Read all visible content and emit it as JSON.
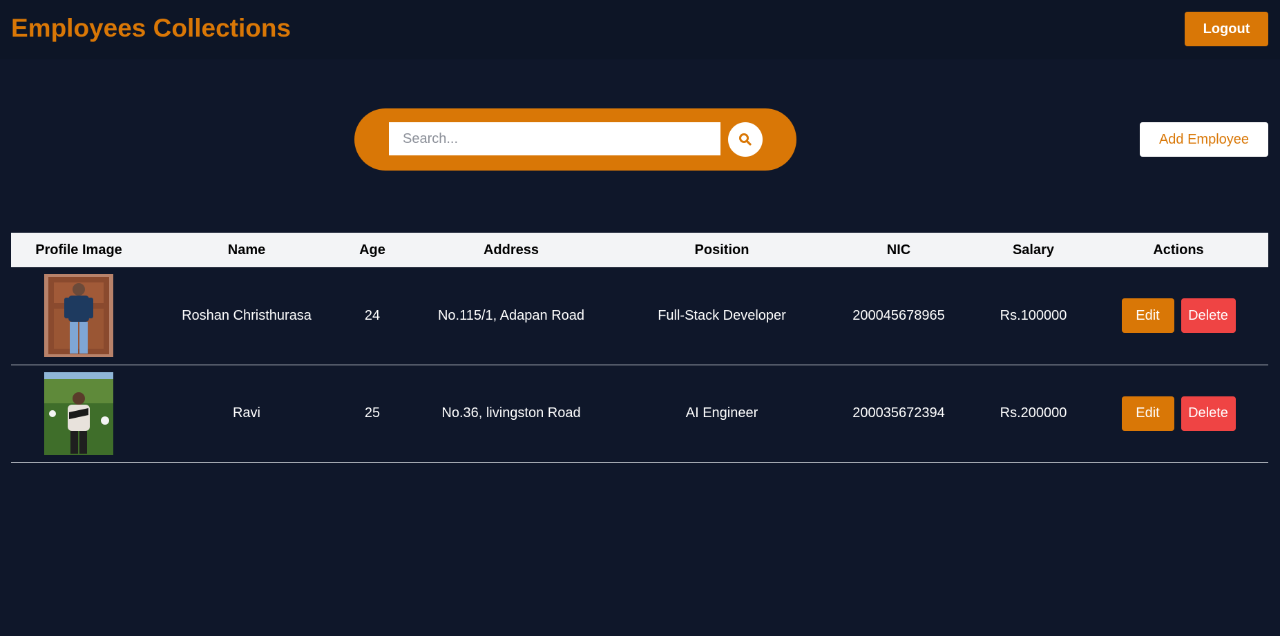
{
  "header": {
    "title": "Employees Collections",
    "logout_label": "Logout"
  },
  "search": {
    "placeholder": "Search...",
    "value": "",
    "icon": "search-icon"
  },
  "add_employee_label": "Add Employee",
  "table": {
    "columns": [
      "Profile Image",
      "Name",
      "Age",
      "Address",
      "Position",
      "NIC",
      "Salary",
      "Actions"
    ],
    "rows": [
      {
        "name": "Roshan Christhurasa",
        "age": "24",
        "address": "No.115/1, Adapan Road",
        "position": "Full-Stack Developer",
        "nic": "200045678965",
        "salary": "Rs.100000",
        "edit_label": "Edit",
        "delete_label": "Delete"
      },
      {
        "name": "Ravi",
        "age": "25",
        "address": "No.36, livingston Road",
        "position": "AI Engineer",
        "nic": "200035672394",
        "salary": "Rs.200000",
        "edit_label": "Edit",
        "delete_label": "Delete"
      }
    ]
  },
  "colors": {
    "background": "#0f172a",
    "accent": "#d97706",
    "danger": "#ef4444",
    "table_header": "#f3f4f6"
  }
}
